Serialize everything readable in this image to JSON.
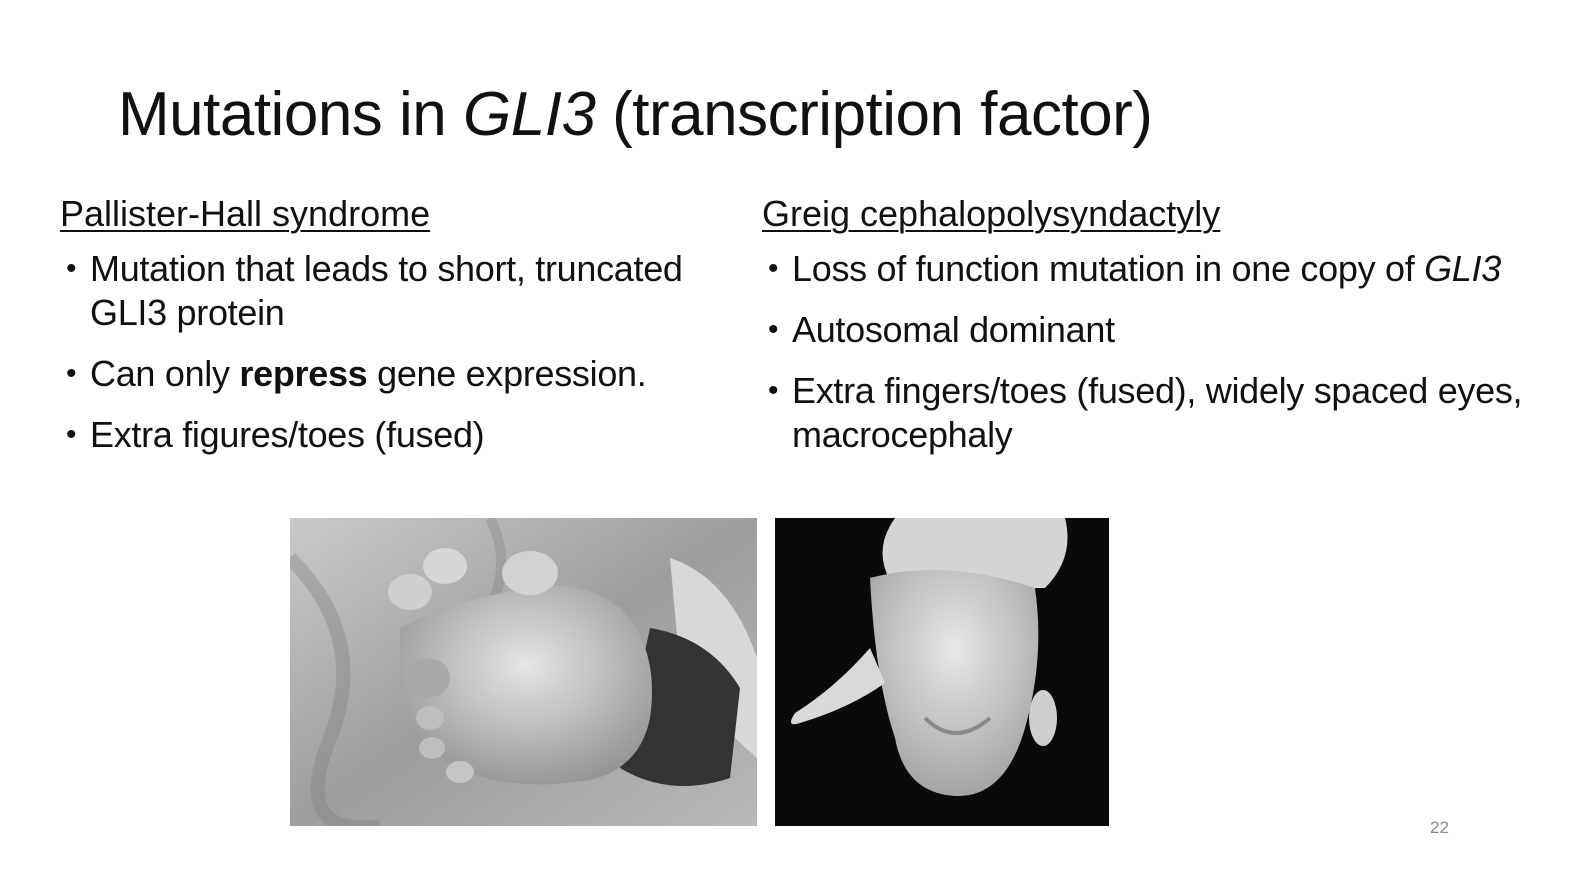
{
  "title": {
    "prefix": "Mutations in ",
    "gene": "GLI3",
    "suffix": " (transcription factor)"
  },
  "left_column": {
    "heading": "Pallister-Hall syndrome",
    "bullets": [
      "Mutation that leads to short, truncated GLI3 protein",
      {
        "before": "Can only ",
        "bold": "repress",
        "after": " gene expression."
      },
      "Extra figures/toes (fused)"
    ]
  },
  "right_column": {
    "heading": "Greig cephalopolysyndactyly",
    "bullets": [
      {
        "text": "Loss of function mutation in one copy of ",
        "italic": "GLI3"
      },
      "Autosomal dominant",
      "Extra fingers/toes (fused), widely spaced eyes, macrocephaly"
    ]
  },
  "page_number": "22",
  "colors": {
    "text": "#111111",
    "page_number": "#8a8a8a",
    "background": "#ffffff"
  }
}
